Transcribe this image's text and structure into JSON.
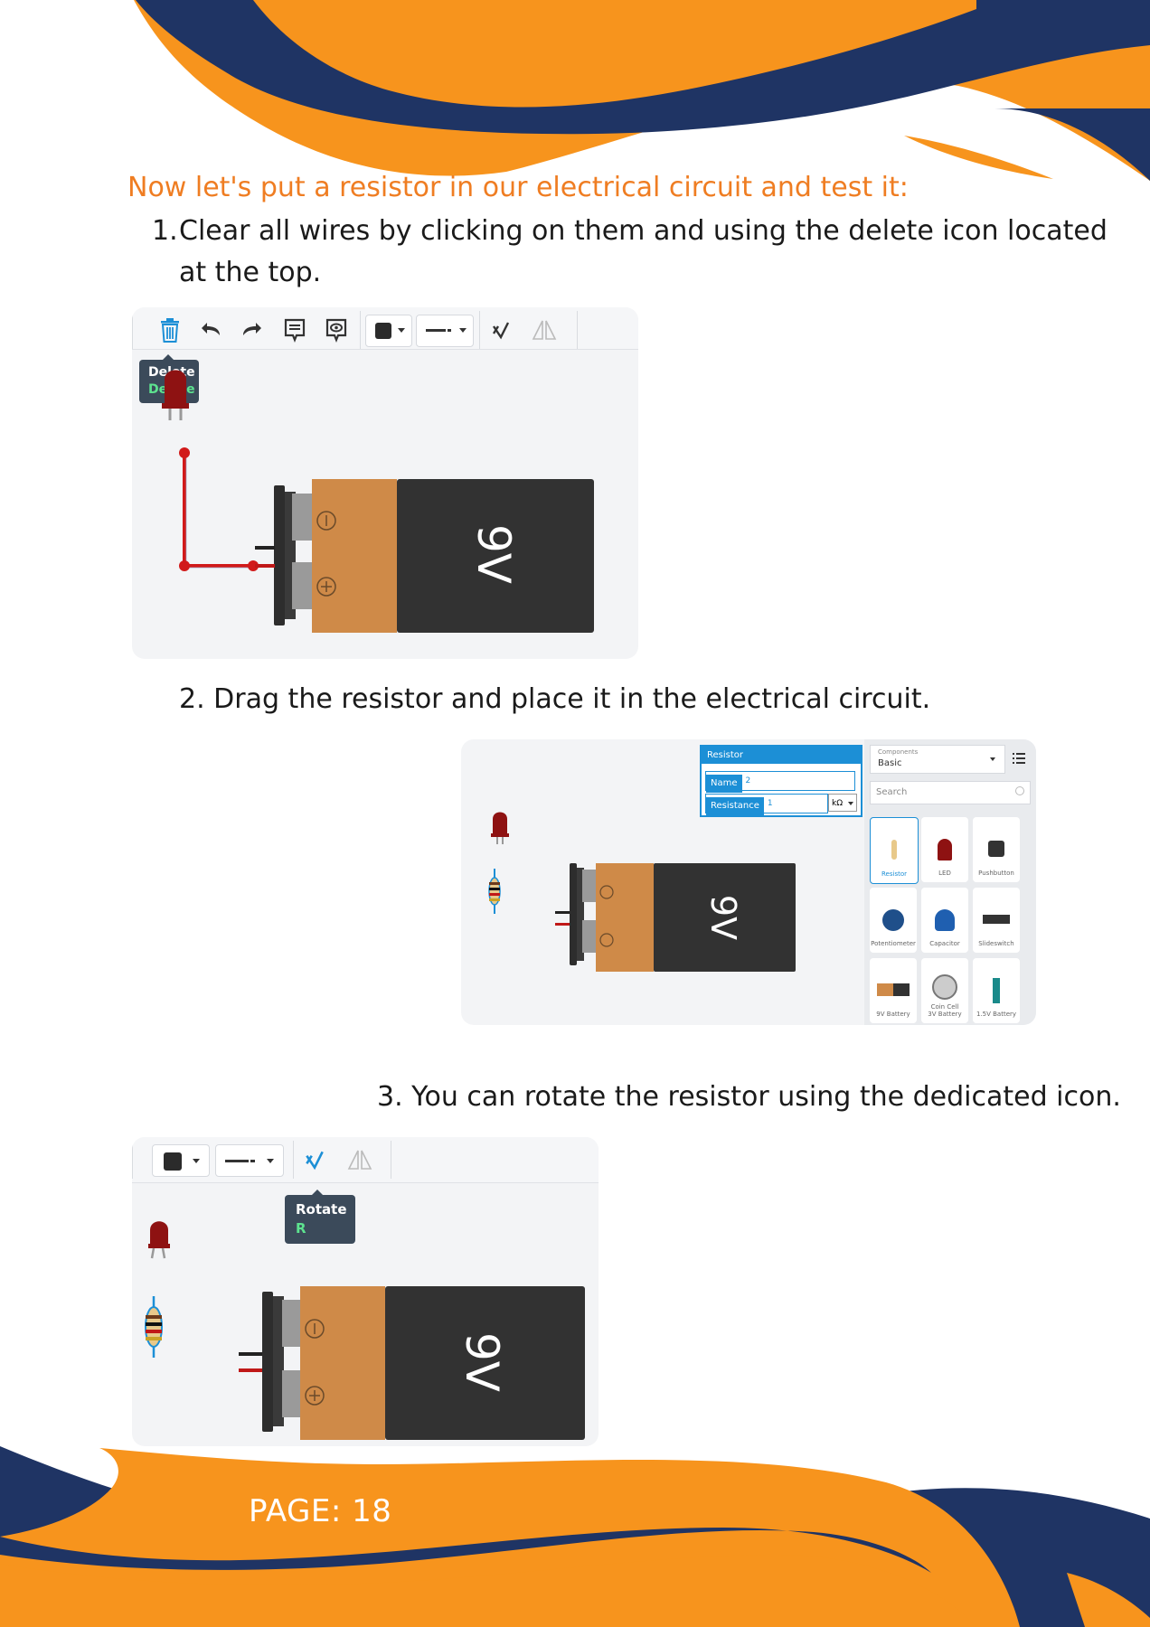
{
  "heading": "Now let's put a resistor in our electrical circuit and test it:",
  "steps": {
    "step1_number": "1.",
    "step1_line1": "Clear all wires by clicking on them and using the delete icon located",
    "step1_line2": "at the top.",
    "step2": "2. Drag the resistor and place it in the electrical circuit.",
    "step3": "3. You can rotate the resistor using the dedicated icon."
  },
  "screenshot1": {
    "tooltip_title": "Delete",
    "tooltip_key": "Delete",
    "battery_label": "9V"
  },
  "screenshot2": {
    "battery_label": "9V",
    "properties": {
      "title": "Resistor",
      "name_label": "Name",
      "name_value": "2",
      "resistance_label": "Resistance",
      "resistance_value": "1",
      "unit": "kΩ"
    },
    "components": {
      "dropdown_caption": "Components",
      "dropdown_value": "Basic",
      "search_placeholder": "Search",
      "items": [
        "Resistor",
        "LED",
        "Pushbutton",
        "Potentiometer",
        "Capacitor",
        "Slideswitch",
        "9V Battery",
        "Coin Cell 3V Battery",
        "1.5V Battery"
      ]
    }
  },
  "screenshot3": {
    "tooltip_title": "Rotate",
    "tooltip_key": "R",
    "battery_label": "9V"
  },
  "footer": {
    "page_label": "PAGE: 18"
  },
  "colors": {
    "orange": "#f7941d",
    "navy": "#1f3464",
    "heading_orange": "#ef7d22",
    "accent_blue": "#1c8fd6"
  }
}
